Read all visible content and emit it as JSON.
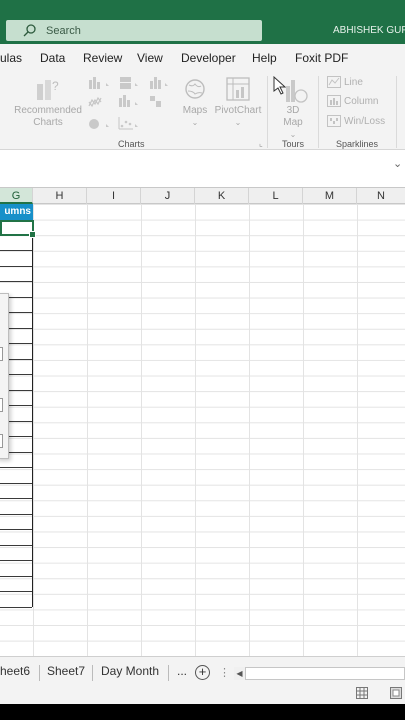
{
  "titlebar": {
    "search_placeholder": "Search",
    "user_name": "ABHISHEK GUPT"
  },
  "menu": {
    "items": [
      "ulas",
      "Data",
      "Review",
      "View",
      "Developer",
      "Help",
      "Foxit PDF"
    ]
  },
  "ribbon": {
    "recommended_charts_line1": "Recommended",
    "recommended_charts_line2": "Charts",
    "maps": "Maps",
    "pivotchart": "PivotChart",
    "map3d_line1": "3D",
    "map3d_line2": "Map",
    "charts_group": "Charts",
    "tours_group": "Tours",
    "sparklines_group": "Sparklines",
    "spark_line": "Line",
    "spark_column": "Column",
    "spark_winloss": "Win/Loss"
  },
  "grid": {
    "columns": [
      "G",
      "H",
      "I",
      "J",
      "K",
      "L",
      "M",
      "N"
    ],
    "selected_column": "G",
    "table_header_fragment": "umns"
  },
  "sheets": {
    "tabs": [
      "heet6",
      "Sheet7",
      "Day Month",
      "..."
    ]
  },
  "colors": {
    "title_green": "#1f7146",
    "table_header_blue": "#1790c9",
    "selection_green": "#217346"
  }
}
